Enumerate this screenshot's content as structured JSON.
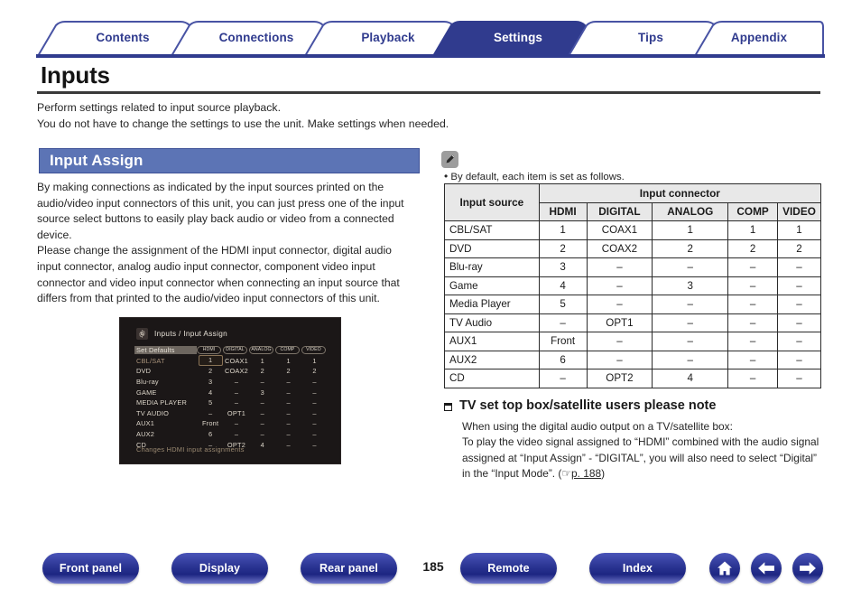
{
  "tabs": [
    {
      "label": "Contents",
      "active": false
    },
    {
      "label": "Connections",
      "active": false
    },
    {
      "label": "Playback",
      "active": false
    },
    {
      "label": "Settings",
      "active": true
    },
    {
      "label": "Tips",
      "active": false
    },
    {
      "label": "Appendix",
      "active": false
    }
  ],
  "page": {
    "title": "Inputs",
    "intro_line1": "Perform settings related to input source playback.",
    "intro_line2": "You do not have to change the settings to use the unit. Make settings when needed.",
    "section_title": "Input Assign",
    "body_p1": "By making connections as indicated by the input sources printed on the audio/video input connectors of this unit, you can just press one of the input source select buttons to easily play back audio or video from a connected device.",
    "body_p2": "Please change the assignment of the HDMI input connector, digital audio input connector, analog audio input connector, component video input connector and video input connector when connecting an input source that differs from that printed to the audio/video input connectors of this unit."
  },
  "osd": {
    "header": "Inputs / Input Assign",
    "col_headers": [
      "HDMI",
      "DIGITAL",
      "ANALOG",
      "COMP",
      "VIDEO"
    ],
    "defaults_label": "Set Defaults",
    "rows": [
      {
        "name": "CBL/SAT",
        "cells": [
          "1",
          "COAX1",
          "1",
          "1",
          "1"
        ],
        "selected": true
      },
      {
        "name": "DVD",
        "cells": [
          "2",
          "COAX2",
          "2",
          "2",
          "2"
        ],
        "selected": false
      },
      {
        "name": "Blu-ray",
        "cells": [
          "3",
          "–",
          "–",
          "–",
          "–"
        ],
        "selected": false
      },
      {
        "name": "GAME",
        "cells": [
          "4",
          "–",
          "3",
          "–",
          "–"
        ],
        "selected": false
      },
      {
        "name": "MEDIA PLAYER",
        "cells": [
          "5",
          "–",
          "–",
          "–",
          "–"
        ],
        "selected": false
      },
      {
        "name": "TV AUDIO",
        "cells": [
          "–",
          "OPT1",
          "–",
          "–",
          "–"
        ],
        "selected": false
      },
      {
        "name": "AUX1",
        "cells": [
          "Front",
          "–",
          "–",
          "–",
          "–"
        ],
        "selected": false
      },
      {
        "name": "AUX2",
        "cells": [
          "6",
          "–",
          "–",
          "–",
          "–"
        ],
        "selected": false
      },
      {
        "name": "CD",
        "cells": [
          "–",
          "OPT2",
          "4",
          "–",
          "–"
        ],
        "selected": false
      }
    ],
    "footer_hint": "Changes HDMI input assignments"
  },
  "note": {
    "icon": "pencil-icon",
    "text": "By default, each item is set as follows."
  },
  "table": {
    "group_header": "Input connector",
    "col_source": "Input source",
    "columns": [
      "HDMI",
      "DIGITAL",
      "ANALOG",
      "COMP",
      "VIDEO"
    ],
    "rows": [
      {
        "source": "CBL/SAT",
        "hdmi": "1",
        "digital": "COAX1",
        "analog": "1",
        "comp": "1",
        "video": "1"
      },
      {
        "source": "DVD",
        "hdmi": "2",
        "digital": "COAX2",
        "analog": "2",
        "comp": "2",
        "video": "2"
      },
      {
        "source": "Blu-ray",
        "hdmi": "3",
        "digital": "–",
        "analog": "–",
        "comp": "–",
        "video": "–"
      },
      {
        "source": "Game",
        "hdmi": "4",
        "digital": "–",
        "analog": "3",
        "comp": "–",
        "video": "–"
      },
      {
        "source": "Media Player",
        "hdmi": "5",
        "digital": "–",
        "analog": "–",
        "comp": "–",
        "video": "–"
      },
      {
        "source": "TV Audio",
        "hdmi": "–",
        "digital": "OPT1",
        "analog": "–",
        "comp": "–",
        "video": "–"
      },
      {
        "source": "AUX1",
        "hdmi": "Front",
        "digital": "–",
        "analog": "–",
        "comp": "–",
        "video": "–"
      },
      {
        "source": "AUX2",
        "hdmi": "6",
        "digital": "–",
        "analog": "–",
        "comp": "–",
        "video": "–"
      },
      {
        "source": "CD",
        "hdmi": "–",
        "digital": "OPT2",
        "analog": "4",
        "comp": "–",
        "video": "–"
      }
    ]
  },
  "subsection": {
    "heading": "TV set top box/satellite users please note",
    "line1": "When using the digital audio output on a TV/satellite box:",
    "line2_a": "To play the video signal assigned to “HDMI” combined with the audio signal assigned at “Input Assign” - “DIGITAL”, you will also need to select “Digital” in the “Input Mode”.  (",
    "link": "p. 188",
    "line2_b": ")"
  },
  "footer": {
    "buttons": [
      {
        "label": "Front panel"
      },
      {
        "label": "Display"
      },
      {
        "label": "Rear panel"
      },
      {
        "label": "Remote"
      },
      {
        "label": "Index"
      }
    ],
    "page_number": "185",
    "icons": [
      "home-icon",
      "arrow-left-icon",
      "arrow-right-icon"
    ]
  },
  "colors": {
    "brand": "#303b8e",
    "section_bar": "#5c74b5",
    "table_header": "#e8e8e8"
  }
}
